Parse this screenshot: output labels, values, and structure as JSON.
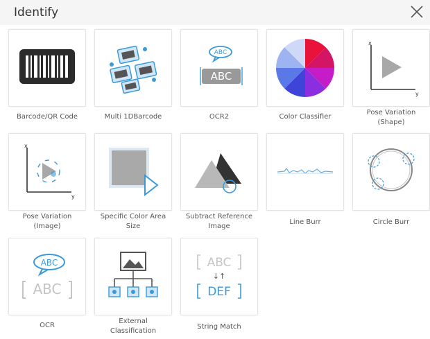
{
  "dialog": {
    "title": "Identify",
    "close_icon": "close-icon"
  },
  "tools": [
    {
      "label": "Barcode/QR Code",
      "icon": "barcode-icon"
    },
    {
      "label": "Multi 1DBarcode",
      "icon": "multi-barcode-icon"
    },
    {
      "label": "OCR2",
      "icon": "ocr2-icon"
    },
    {
      "label": "Color Classifier",
      "icon": "color-wheel-icon"
    },
    {
      "label": "Pose Variation\n(Shape)",
      "icon": "pose-shape-icon"
    },
    {
      "label": "Pose Variation\n(Image)",
      "icon": "pose-image-icon"
    },
    {
      "label": "Specific Color Area\nSize",
      "icon": "color-area-icon"
    },
    {
      "label": "Subtract Reference\nImage",
      "icon": "subtract-reference-icon"
    },
    {
      "label": "Line Burr",
      "icon": "line-burr-icon"
    },
    {
      "label": "Circle Burr",
      "icon": "circle-burr-icon"
    },
    {
      "label": "OCR",
      "icon": "ocr-icon"
    },
    {
      "label": "External\nClassification",
      "icon": "external-classification-icon"
    },
    {
      "label": "String Match",
      "icon": "string-match-icon"
    }
  ],
  "icon_text": {
    "abc": "ABC",
    "def": "DEF",
    "arrows": "↓↑",
    "axis_x": "x",
    "axis_y": "y"
  },
  "colors": {
    "accent_blue": "#3a9ad9",
    "icon_gray": "#9a9a9a",
    "dark": "#333333"
  }
}
